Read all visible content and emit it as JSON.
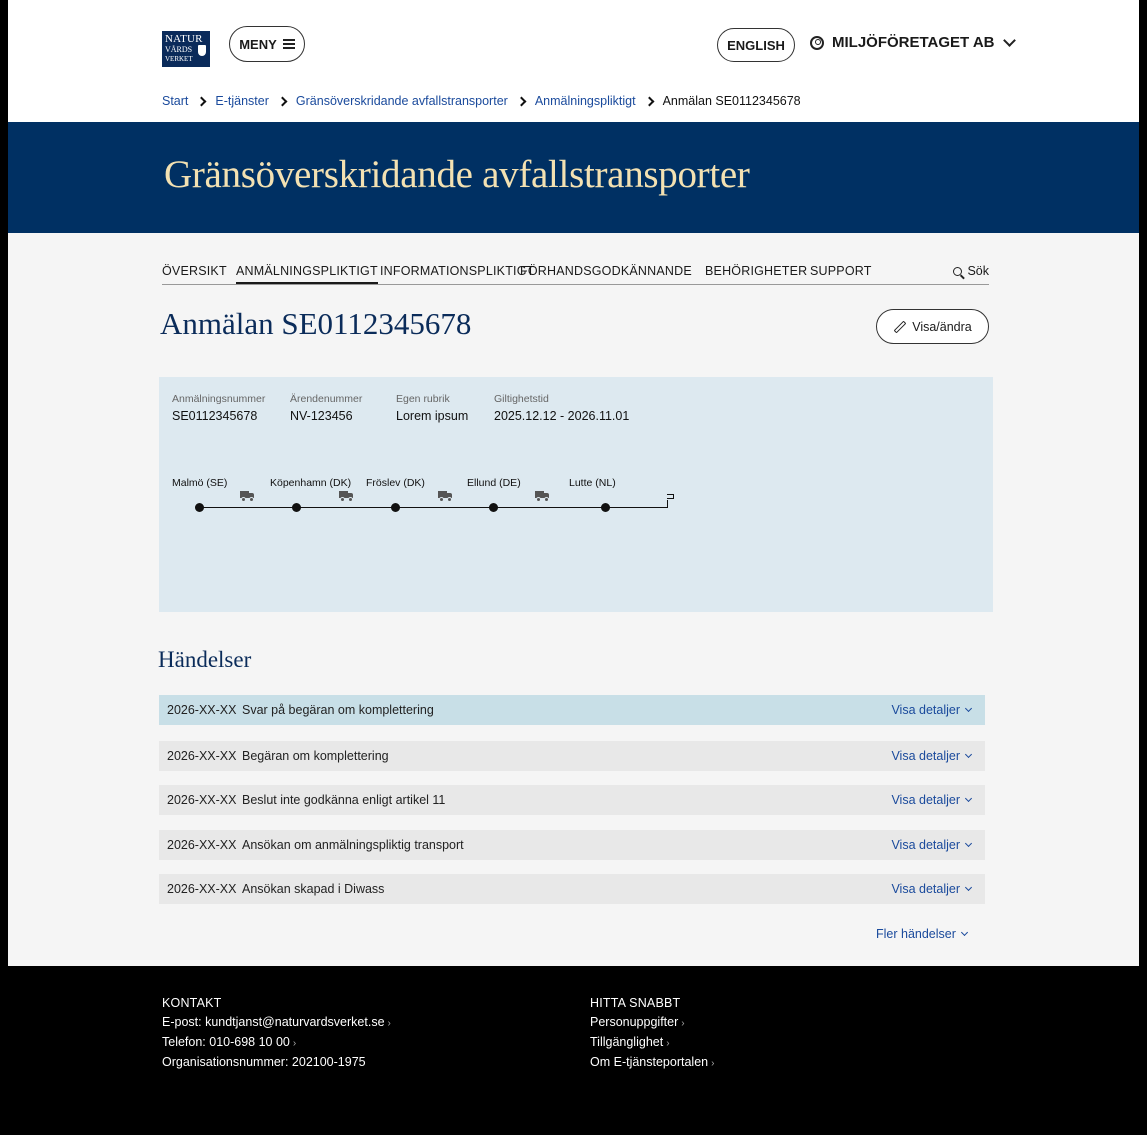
{
  "logo": {
    "line1": "NATUR",
    "line2": "VÅRDS",
    "line3": "VERKET"
  },
  "header": {
    "menu_label": "MENY",
    "language_label": "ENGLISH",
    "account_label": "MILJÖFÖRETAGET AB"
  },
  "breadcrumb": {
    "items": [
      "Start",
      "E-tjänster",
      "Gränsöverskridande avfallstransporter",
      "Anmälningspliktigt"
    ],
    "current": "Anmälan SE0112345678"
  },
  "hero": {
    "title": "Gränsöverskridande avfallstransporter"
  },
  "subnav": {
    "items": [
      "ÖVERSIKT",
      "ANMÄLNINGSPLIKTIGT",
      "INFORMATIONSPLIKTIGT",
      "FÖRHANDSGODKÄNNANDE",
      "BEHÖRIGHETER",
      "SUPPORT"
    ],
    "active": "ANMÄLNINGSPLIKTIGT",
    "search_label": "Sök"
  },
  "page": {
    "title": "Anmälan SE0112345678",
    "edit_label": "Visa/ändra"
  },
  "info": {
    "fields": [
      {
        "label": "Anmälningsnummer",
        "value": "SE0112345678"
      },
      {
        "label": "Ärendenummer",
        "value": "NV-123456"
      },
      {
        "label": "Egen rubrik",
        "value": "Lorem ipsum"
      },
      {
        "label": "Giltighetstid",
        "value": "2025.12.12 - 2026.11.01"
      }
    ],
    "route": [
      "Malmö (SE)",
      "Köpenhamn (DK)",
      "Fröslev (DK)",
      "Ellund (DE)",
      "Lutte (NL)"
    ]
  },
  "events": {
    "title": "Händelser",
    "details_label": "Visa detaljer",
    "more_label": "Fler händelser",
    "rows": [
      {
        "date": "2026-XX-XX",
        "text": "Svar på begäran om komplettering"
      },
      {
        "date": "2026-XX-XX",
        "text": "Begäran om komplettering"
      },
      {
        "date": "2026-XX-XX",
        "text": "Beslut inte godkänna enligt artikel 11"
      },
      {
        "date": "2026-XX-XX",
        "text": "Ansökan om anmälningspliktig transport"
      },
      {
        "date": "2026-XX-XX",
        "text": "Ansökan skapad i Diwass"
      }
    ]
  },
  "footer": {
    "contact": {
      "heading": "KONTAKT",
      "email": "E-post: kundtjanst@naturvardsverket.se",
      "phone": "Telefon: 010-698 10 00",
      "orgnr": "Organisationsnummer: 202100-1975"
    },
    "quick": {
      "heading": "HITTA SNABBT",
      "links": [
        "Personuppgifter",
        "Tillgänglighet",
        "Om E-tjänsteportalen"
      ]
    }
  }
}
